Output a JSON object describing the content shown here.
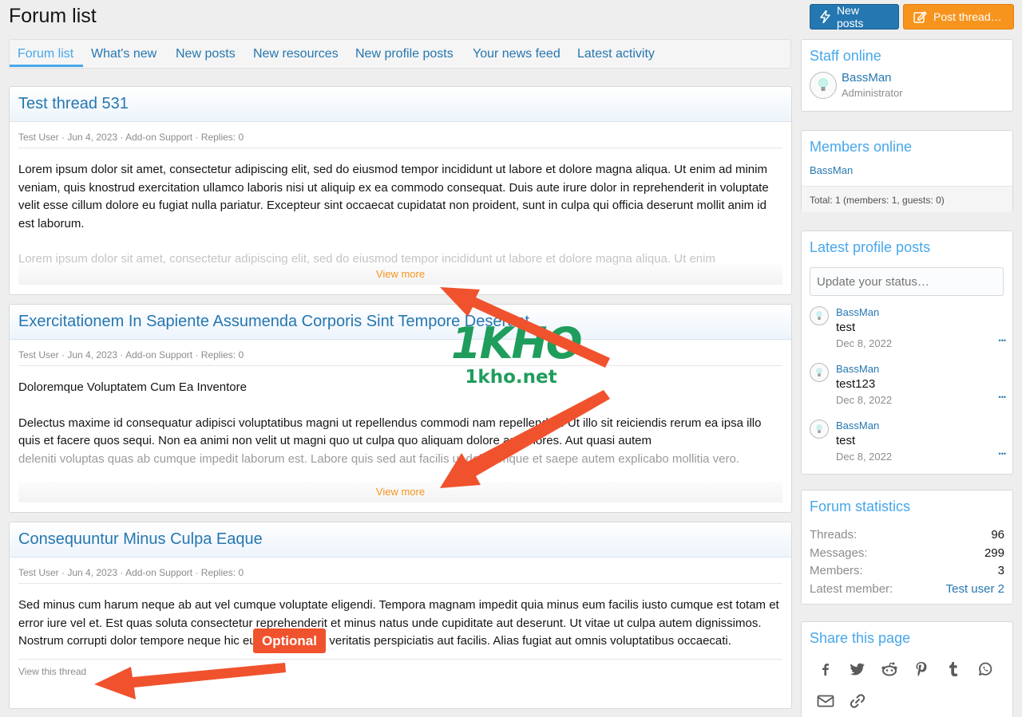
{
  "header": {
    "title": "Forum list",
    "new_posts_button": "New posts",
    "post_thread_button": "Post thread…"
  },
  "tabs": [
    {
      "label": "Forum list"
    },
    {
      "label": "What's new"
    },
    {
      "label": "New posts"
    },
    {
      "label": "New resources"
    },
    {
      "label": "New profile posts"
    },
    {
      "label": "Your news feed"
    },
    {
      "label": "Latest activity"
    }
  ],
  "threads": [
    {
      "title": "Test thread 531",
      "meta": "Test User · Jun 4, 2023 · Add-on Support · Replies: 0",
      "body": "Lorem ipsum dolor sit amet, consectetur adipiscing elit, sed do eiusmod tempor incididunt ut labore et dolore magna aliqua. Ut enim ad minim veniam, quis knostrud exercitation ullamco laboris nisi ut aliquip ex ea commodo consequat. Duis aute irure dolor in reprehenderit in voluptate velit esse cillum dolore eu fugiat nulla pariatur. Excepteur sint occaecat cupidatat non proident, sunt in culpa qui officia deserunt mollit anim id est laborum.",
      "faded": "Lorem ipsum dolor sit amet, consectetur adipiscing elit, sed do eiusmod tempor incididunt ut labore et dolore magna aliqua. Ut enim",
      "view_more": "View more"
    },
    {
      "title": "Exercitationem In Sapiente Assumenda Corporis Sint Tempore Deserunt",
      "meta": "Test User · Jun 4, 2023 · Add-on Support · Replies: 0",
      "subtitle": "Doloremque Voluptatem Cum Ea Inventore",
      "body": "Delectus maxime id consequatur adipisci voluptatibus magni ut repellendus commodi nam repellendus. Ut illo sit reiciendis rerum ea ipsa illo quis et facere quos sequi. Non ea animi non velit ut magni quo ut culpa quo aliquam dolore asperiores. Aut quasi autem",
      "faded": "deleniti voluptas quas ab cumque impedit laborum est. Labore quis sed aut facilis ut doloremque et saepe autem explicabo mollitia vero.",
      "view_more": "View more"
    },
    {
      "title": "Consequuntur Minus Culpa Eaque",
      "meta": "Test User · Jun 4, 2023 · Add-on Support · Replies: 0",
      "body": "Sed minus cum harum neque ab aut vel cumque voluptate eligendi. Tempora magnam impedit quia minus eum facilis iusto cumque est totam et error iure vel et. Est quas soluta consectetur reprehenderit et minus natus unde cupiditate aut deserunt. Ut vitae ut culpa autem dignissimos. Nostrum corrupti dolor tempore neque hic eum dolorem et veritatis perspiciatis aut facilis. Alias fugiat aut omnis voluptatibus occaecati.",
      "view_thread": "View this thread"
    }
  ],
  "sidebar": {
    "staff": {
      "title": "Staff online",
      "name": "BassMan",
      "role": "Administrator"
    },
    "members": {
      "title": "Members online",
      "name": "BassMan",
      "total": "Total: 1 (members: 1, guests: 0)"
    },
    "profile_posts": {
      "title": "Latest profile posts",
      "placeholder": "Update your status…",
      "items": [
        {
          "name": "BassMan",
          "text": "test",
          "date": "Dec 8, 2022"
        },
        {
          "name": "BassMan",
          "text": "test123",
          "date": "Dec 8, 2022"
        },
        {
          "name": "BassMan",
          "text": "test",
          "date": "Dec 8, 2022"
        }
      ],
      "more": "•••"
    },
    "stats": {
      "title": "Forum statistics",
      "rows": [
        {
          "k": "Threads:",
          "v": "96"
        },
        {
          "k": "Messages:",
          "v": "299"
        },
        {
          "k": "Members:",
          "v": "3"
        },
        {
          "k": "Latest member:",
          "v": "Test user 2"
        }
      ]
    },
    "share": {
      "title": "Share this page",
      "icons": [
        "facebook-icon",
        "twitter-icon",
        "reddit-icon",
        "pinterest-icon",
        "tumblr-icon",
        "whatsapp-icon",
        "email-icon",
        "link-icon"
      ]
    }
  },
  "annotations": {
    "optional": "Optional",
    "watermark_logo": "1KHO",
    "watermark_url": "1kho.net"
  },
  "colors": {
    "accent": "#2577b1",
    "accent_light": "#47a7eb",
    "orange": "#f7941d",
    "annotation_red": "#f0522d",
    "watermark_green": "#1f9d5c"
  }
}
